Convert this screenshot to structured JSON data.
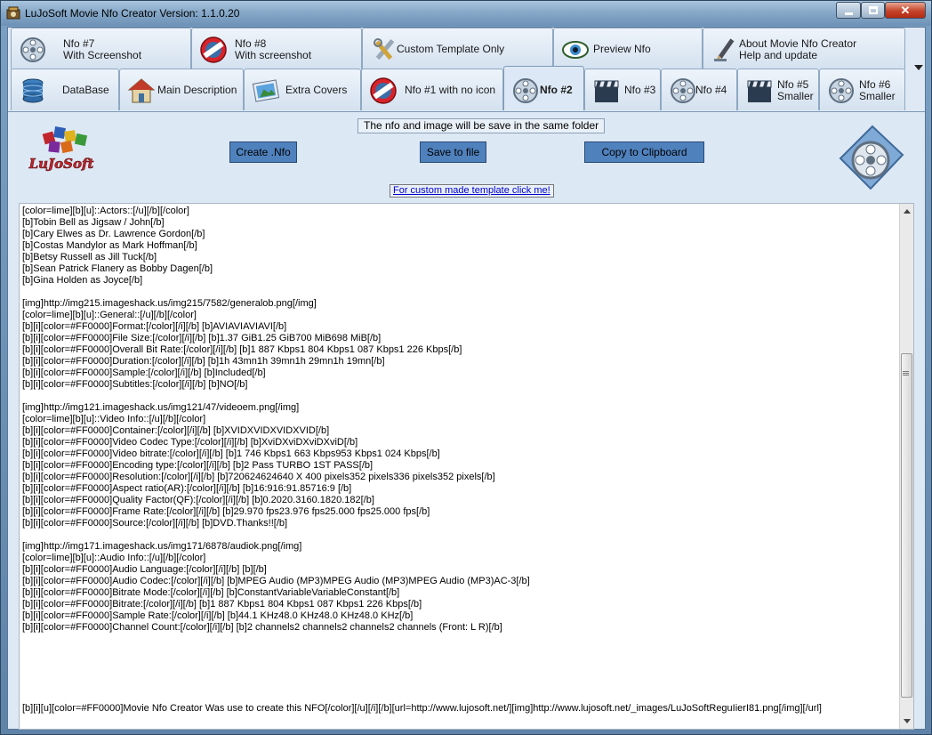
{
  "window": {
    "title": "LuJoSoft Movie Nfo Creator Version: 1.1.0.20",
    "icons": {
      "app": "film-icon",
      "minimize": "minimize-icon",
      "maximize": "maximize-icon",
      "close": "close-icon"
    }
  },
  "tabs_row1": [
    {
      "line1": "Nfo #7",
      "line2": "With Screenshot",
      "icon": "film-reel-icon"
    },
    {
      "line1": "Nfo #8",
      "line2": "With screenshot",
      "icon": "no-entry-icon"
    },
    {
      "line1": "Custom Template Only",
      "line2": "",
      "icon": "tools-icon"
    },
    {
      "line1": "Preview Nfo",
      "line2": "",
      "icon": "eye-icon"
    },
    {
      "line1": "About Movie Nfo Creator",
      "line2": "Help and update",
      "icon": "pen-icon"
    }
  ],
  "tabs_row2": [
    {
      "line1": "DataBase",
      "line2": "",
      "icon": "database-icon"
    },
    {
      "line1": "Main Description",
      "line2": "",
      "icon": "house-icon"
    },
    {
      "line1": "Extra Covers",
      "line2": "",
      "icon": "picture-icon"
    },
    {
      "line1": "Nfo #1 with no icon",
      "line2": "",
      "icon": "no-entry-icon"
    },
    {
      "line1": "Nfo #2",
      "line2": "",
      "icon": "film-reel-icon",
      "active": true
    },
    {
      "line1": "Nfo #3",
      "line2": "",
      "icon": "clapperboard-icon"
    },
    {
      "line1": "Nfo #4",
      "line2": "",
      "icon": "film-reel-icon"
    },
    {
      "line1": "Nfo #5",
      "line2": "Smaller",
      "icon": "clapperboard-icon"
    },
    {
      "line1": "Nfo #6",
      "line2": "Smaller",
      "icon": "film-reel-icon"
    }
  ],
  "panel": {
    "info": "The nfo and image will be save in the same folder",
    "create_label": "Create .Nfo",
    "save_label": "Save to file",
    "copy_label": "Copy to Clipboard",
    "custom_link": "For custom made template click me!",
    "logo_text": "LuJoSoft",
    "colors": {
      "button": "#4f81bd",
      "panel": "#dde8f5",
      "link": "#0000d0"
    }
  },
  "nfo_lines": [
    "[color=lime][b][u]::Actors::[/u][/b][/color]",
    "[b]Tobin Bell as Jigsaw / John[/b]",
    "[b]Cary Elwes as Dr. Lawrence Gordon[/b]",
    "[b]Costas Mandylor as Mark Hoffman[/b]",
    "[b]Betsy Russell as Jill Tuck[/b]",
    "[b]Sean Patrick Flanery as Bobby Dagen[/b]",
    "[b]Gina Holden as Joyce[/b]",
    "",
    "[img]http://img215.imageshack.us/img215/7582/generalob.png[/img]",
    "[color=lime][b][u]::General::[/u][/b][/color]",
    "[b][i][color=#FF0000]Format:[/color][/i][/b] [b]AVIAVIAVIAVI[/b]",
    "[b][i][color=#FF0000]File Size:[/color][/i][/b] [b]1.37 GiB1.25 GiB700 MiB698 MiB[/b]",
    "[b][i][color=#FF0000]Overall Bit Rate:[/color][/i][/b] [b]1 887 Kbps1 804 Kbps1 087 Kbps1 226 Kbps[/b]",
    "[b][i][color=#FF0000]Duration:[/color][/i][/b] [b]1h 43mn1h 39mn1h 29mn1h 19mn[/b]",
    "[b][i][color=#FF0000]Sample:[/color][/i][/b] [b]Included[/b]",
    "[b][i][color=#FF0000]Subtitles:[/color][/i][/b] [b]NO[/b]",
    "",
    "[img]http://img121.imageshack.us/img121/47/videoem.png[/img]",
    "[color=lime][b][u]::Video Info::[/u][/b][/color]",
    "[b][i][color=#FF0000]Container:[/color][/i][/b] [b]XVIDXVIDXVIDXVID[/b]",
    "[b][i][color=#FF0000]Video Codec Type:[/color][/i][/b] [b]XviDXviDXviDXviD[/b]",
    "[b][i][color=#FF0000]Video bitrate:[/color][/i][/b] [b]1 746 Kbps1 663 Kbps953 Kbps1 024 Kbps[/b]",
    "[b][i][color=#FF0000]Encoding type:[/color][/i][/b] [b]2 Pass TURBO 1ST PASS[/b]",
    "[b][i][color=#FF0000]Resolution:[/color][/i][/b] [b]720624624640 X 400 pixels352 pixels336 pixels352 pixels[/b]",
    "[b][i][color=#FF0000]Aspect ratio(AR):[/color][/i][/b] [b]16:916:91.85716:9 [/b]",
    "[b][i][color=#FF0000]Quality Factor(QF):[/color][/i][/b] [b]0.2020.3160.1820.182[/b]",
    "[b][i][color=#FF0000]Frame Rate:[/color][/i][/b] [b]29.970 fps23.976 fps25.000 fps25.000 fps[/b]",
    "[b][i][color=#FF0000]Source:[/color][/i][/b] [b]DVD.Thanks!![/b]",
    "",
    "[img]http://img171.imageshack.us/img171/6878/audiok.png[/img]",
    "[color=lime][b][u]::Audio Info::[/u][/b][/color]",
    "[b][i][color=#FF0000]Audio Language:[/color][/i][/b] [b][/b]",
    "[b][i][color=#FF0000]Audio Codec:[/color][/i][/b] [b]MPEG Audio (MP3)MPEG Audio (MP3)MPEG Audio (MP3)AC-3[/b]",
    "[b][i][color=#FF0000]Bitrate Mode:[/color][/i][/b] [b]ConstantVariableVariableConstant[/b]",
    "[b][i][color=#FF0000]Bitrate:[/color][/i][/b] [b]1 887 Kbps1 804 Kbps1 087 Kbps1 226 Kbps[/b]",
    "[b][i][color=#FF0000]Sample Rate:[/color][/i][/b] [b]44.1 KHz48.0 KHz48.0 KHz48.0 KHz[/b]",
    "[b][i][color=#FF0000]Channel Count:[/color][/i][/b] [b]2 channels2 channels2 channels2 channels (Front: L R)[/b]",
    "",
    "",
    "",
    "",
    "",
    "",
    "[b][i][u][color=#FF0000]Movie Nfo Creator Was use to create this NFO[/color][/u][/i][/b][url=http://www.lujosoft.net/][img]http://www.lujosoft.net/_images/LuJoSoftReguIierI81.png[/img][/url]"
  ]
}
